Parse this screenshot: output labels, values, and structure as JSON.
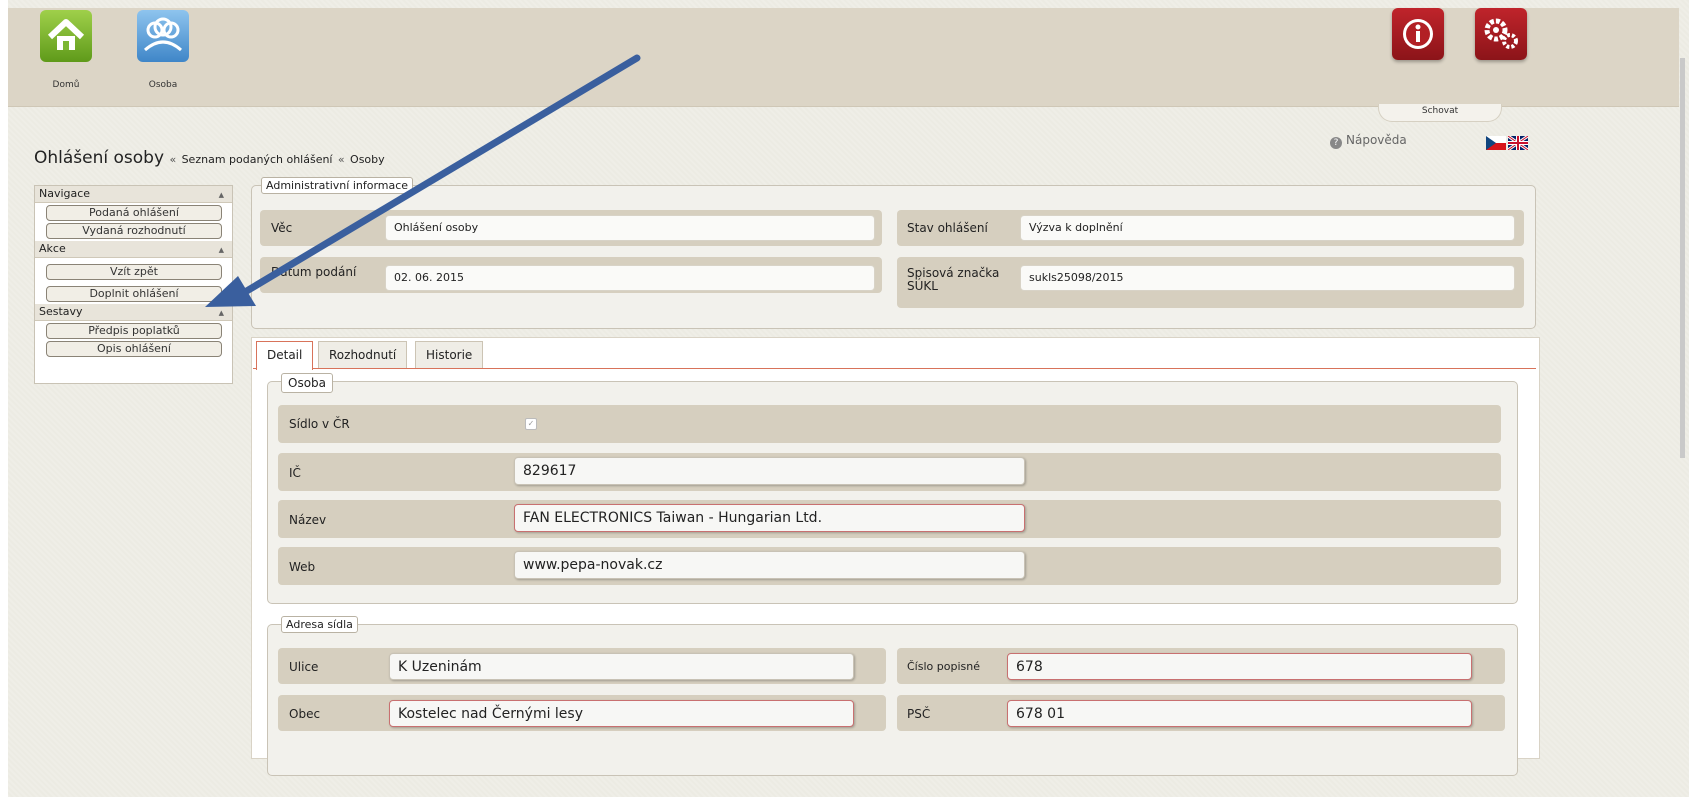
{
  "topbar": {
    "home_label": "Domů",
    "person_label": "Osoba",
    "hide_label": "Schovat",
    "help_label": "Nápověda",
    "icons": {
      "info": "info-icon",
      "settings": "gears-icon",
      "home": "home-icon",
      "people": "people-icon"
    }
  },
  "breadcrumb": {
    "title": "Ohlášení osoby",
    "sep": "«",
    "link1": "Seznam podaných ohlášení",
    "link2": "Osoby"
  },
  "sidebar": {
    "sections": [
      {
        "title": "Navigace",
        "items": [
          "Podaná ohlášení",
          "Vydaná rozhodnutí"
        ]
      },
      {
        "title": "Akce",
        "items": [
          "Vzít zpět",
          "Doplnit ohlášení"
        ]
      },
      {
        "title": "Sestavy",
        "items": [
          "Předpis poplatků",
          "Opis ohlášení"
        ]
      }
    ]
  },
  "admin": {
    "legend": "Administrativní informace",
    "vec_label": "Věc",
    "vec_value": "Ohlášení osoby",
    "stav_label": "Stav ohlášení",
    "stav_value": "Výzva k doplnění",
    "datum_label": "Datum podání",
    "datum_value": "02. 06. 2015",
    "spis_label": "Spisová značka SÚKL",
    "spis_value": "sukls25098/2015"
  },
  "tabs": [
    "Detail",
    "Rozhodnutí",
    "Historie"
  ],
  "osoba": {
    "legend": "Osoba",
    "sidlo_label": "Sídlo v ČR",
    "ic_label": "IČ",
    "ic_value": "829617",
    "nazev_label": "Název",
    "nazev_value": "FAN ELECTRONICS Taiwan - Hungarian Ltd.",
    "web_label": "Web",
    "web_value": "www.pepa-novak.cz"
  },
  "adresa": {
    "legend": "Adresa sídla",
    "ulice_label": "Ulice",
    "ulice_value": "K Uzeninám",
    "cislo_label": "Číslo popisné",
    "cislo_value": "678",
    "obec_label": "Obec",
    "obec_value": "Kostelec nad Černými lesy",
    "psc_label": "PSČ",
    "psc_value": "678 01"
  },
  "colors": {
    "accent": "#d8735a",
    "arrow": "#3a5f9e",
    "danger": "#c0242b"
  }
}
